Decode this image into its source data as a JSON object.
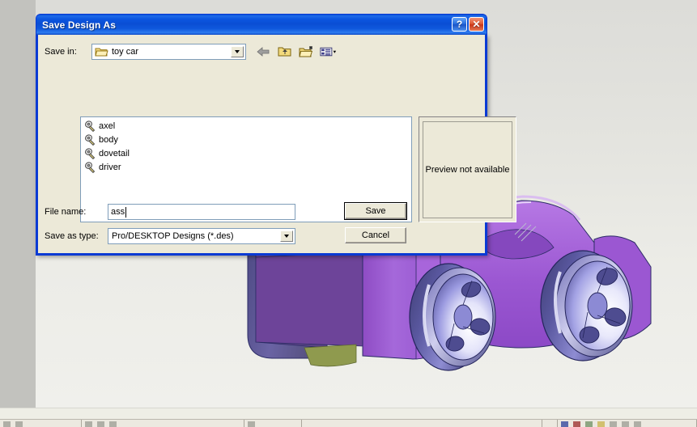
{
  "desktop": {
    "background_color": "#c2c2be",
    "viewport": {
      "name": "cad-viewport",
      "background_gradient_top": "#dcdcd8",
      "background_gradient_bottom": "#f0f0ec",
      "model_description": "purple 3D toy car model",
      "model_colors": {
        "body_main": "#9b59d0",
        "body_dark": "#6b4096",
        "body_highlight": "#c89ae8",
        "wheel_dark": "#4a4a8c",
        "wheel_light": "#b6b6f0",
        "accent_green": "#8f9a4e"
      }
    },
    "taskbar": {
      "name": "cut-off-toolbar",
      "background_color": "#eeeee6"
    }
  },
  "dialog": {
    "title": "Save Design As",
    "title_buttons": {
      "help_label": "?",
      "close_label": "✕"
    },
    "save_in": {
      "label": "Save in:",
      "value": "toy car",
      "folder_icon": "folder-icon",
      "dropdown_icon": "chevron-down-icon"
    },
    "toolbar": {
      "back_icon": "back-arrow-icon",
      "up_icon": "up-one-level-icon",
      "new_folder_icon": "new-folder-icon",
      "views_icon": "views-menu-icon"
    },
    "files": [
      {
        "name": "axel",
        "icon": "des-file-icon"
      },
      {
        "name": "body",
        "icon": "des-file-icon"
      },
      {
        "name": "dovetail",
        "icon": "des-file-icon"
      },
      {
        "name": "driver",
        "icon": "des-file-icon"
      }
    ],
    "preview": {
      "text": "Preview not available"
    },
    "file_name": {
      "label": "File name:",
      "value": "ass"
    },
    "save_as_type": {
      "label": "Save as type:",
      "value": "Pro/DESKTOP Designs (*.des)"
    },
    "buttons": {
      "save_label": "Save",
      "cancel_label": "Cancel"
    }
  }
}
